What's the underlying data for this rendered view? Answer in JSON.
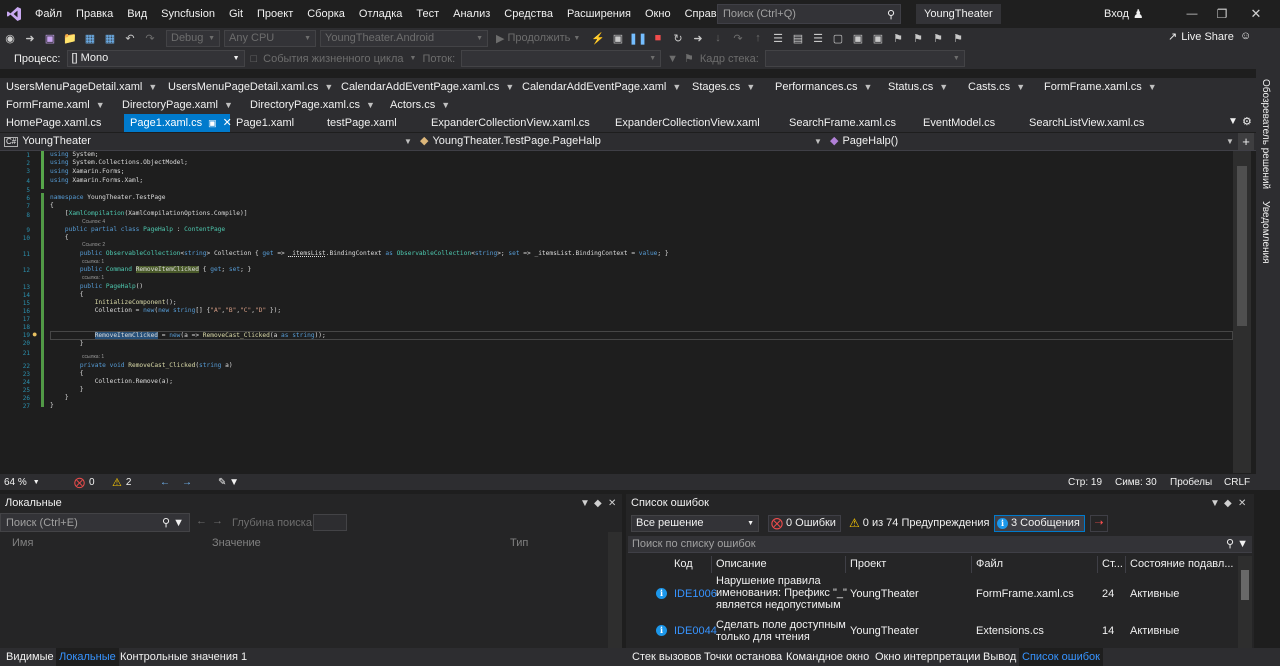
{
  "menu": {
    "items": [
      "Файл",
      "Правка",
      "Вид",
      "Syncfusion",
      "Git",
      "Проект",
      "Сборка",
      "Отладка",
      "Тест",
      "Анализ",
      "Средства",
      "Расширения",
      "Окно",
      "Справка"
    ],
    "search_placeholder": "Поиск (Ctrl+Q)",
    "app_title": "YoungTheater",
    "login": "Вход",
    "live_share": "Live Share"
  },
  "toolbar": {
    "config": "Debug",
    "platform": "Any CPU",
    "target": "YoungTheater.Android",
    "continue": "Продолжить"
  },
  "procbar": {
    "process_label": "Процесс:",
    "process_value": "[] Mono",
    "lifecycle": "События жизненного цикла",
    "thread_label": "Поток:",
    "stack_label": "Кадр стека:"
  },
  "tabs": {
    "row1": [
      "UsersMenuPageDetail.xaml",
      "UsersMenuPageDetail.xaml.cs",
      "CalendarAddEventPage.xaml.cs",
      "CalendarAddEventPage.xaml",
      "Stages.cs",
      "Performances.cs",
      "Status.cs",
      "Casts.cs",
      "FormFrame.xaml.cs"
    ],
    "row2": [
      "FormFrame.xaml",
      "DirectoryPage.xaml",
      "DirectoryPage.xaml.cs",
      "Actors.cs"
    ],
    "row3": [
      "HomePage.xaml.cs",
      "Page1.xaml.cs",
      "Page1.xaml",
      "testPage.xaml",
      "ExpanderCollectionView.xaml.cs",
      "ExpanderCollectionView.xaml",
      "SearchFrame.xaml.cs",
      "EventModel.cs",
      "SearchListView.xaml.cs"
    ]
  },
  "navbar": {
    "project": "YoungTheater",
    "type": "YoungTheater.TestPage.PageHalp",
    "member": "PageHalp()"
  },
  "editor": {
    "line_numbers": [
      "1",
      "2",
      "3",
      "4",
      "5",
      "6",
      "7",
      "8",
      "9",
      "10",
      "11",
      "12",
      "13",
      "14",
      "15",
      "16",
      "17",
      "18",
      "19",
      "20",
      "21",
      "22",
      "23",
      "24",
      "25",
      "26",
      "27"
    ],
    "lens": {
      "l8": "Ссылок: 4",
      "l10": "Ссылок: 2",
      "l11": "ссылка: 1",
      "l12": "ссылка: 1",
      "l21": "ссылка: 1"
    },
    "code": {
      "using1": "System;",
      "using2": "System.Collections.ObjectModel;",
      "using3": "Xamarin.Forms;",
      "using4": "Xamarin.Forms.Xaml;",
      "ns": "YoungTheater.TestPage",
      "attr": "XamlCompilation",
      "attr_args": "(XamlCompilationOptions.Compile)]",
      "class_name": "PageHalp",
      "base": "ContentPage",
      "prop_coll": "Collection",
      "items_list": "_itemsList",
      "binding_ctx": ".BindingContext",
      "cmd_name": "RemoveItemClicked",
      "init": "InitializeComponent",
      "cast_handler": "RemoveCast_Clicked",
      "coll_remove": "Collection.Remove(a);"
    }
  },
  "ed_status": {
    "zoom": "64 %",
    "errors": "0",
    "warnings": "2",
    "line": "Стр: 19",
    "col": "Симв: 30",
    "spaces": "Пробелы",
    "eol": "CRLF"
  },
  "right_rail": {
    "tab1": "Обозреватель решений",
    "tab2": "Уведомления"
  },
  "locals": {
    "title": "Локальные",
    "search_placeholder": "Поиск (Ctrl+E)",
    "depth_label": "Глубина поиска:",
    "col_name": "Имя",
    "col_value": "Значение",
    "col_type": "Тип"
  },
  "errlist": {
    "title": "Список ошибок",
    "scope": "Все решение",
    "errors": "0 Ошибки",
    "warnings": "0 из 74 Предупреждения",
    "messages": "3 Сообщения",
    "search_placeholder": "Поиск по списку ошибок",
    "headers": {
      "code": "Код",
      "desc": "Описание",
      "project": "Проект",
      "file": "Файл",
      "line": "Ст...",
      "state": "Состояние подавл..."
    },
    "rows": [
      {
        "code": "IDE1006",
        "desc1": "Нарушение правила",
        "desc2": "именования: Префикс \"_\"",
        "desc3": "является недопустимым",
        "project": "YoungTheater",
        "file": "FormFrame.xaml.cs",
        "line": "24",
        "state": "Активные"
      },
      {
        "code": "IDE0044",
        "desc1": "Сделать поле доступным",
        "desc2": "только для чтения",
        "desc3": "",
        "project": "YoungTheater",
        "file": "Extensions.cs",
        "line": "14",
        "state": "Активные"
      }
    ]
  },
  "bottomtabs": {
    "left": [
      "Видимые",
      "Локальные",
      "Контрольные значения 1"
    ],
    "right": [
      "Стек вызовов",
      "Точки останова",
      "Командное окно",
      "Окно интерпретации",
      "Вывод",
      "Список ошибок"
    ]
  },
  "colors": {
    "accent": "#007acc",
    "link": "#3794ff",
    "bg": "#1e1e1e",
    "chrome": "#2d2d30"
  }
}
